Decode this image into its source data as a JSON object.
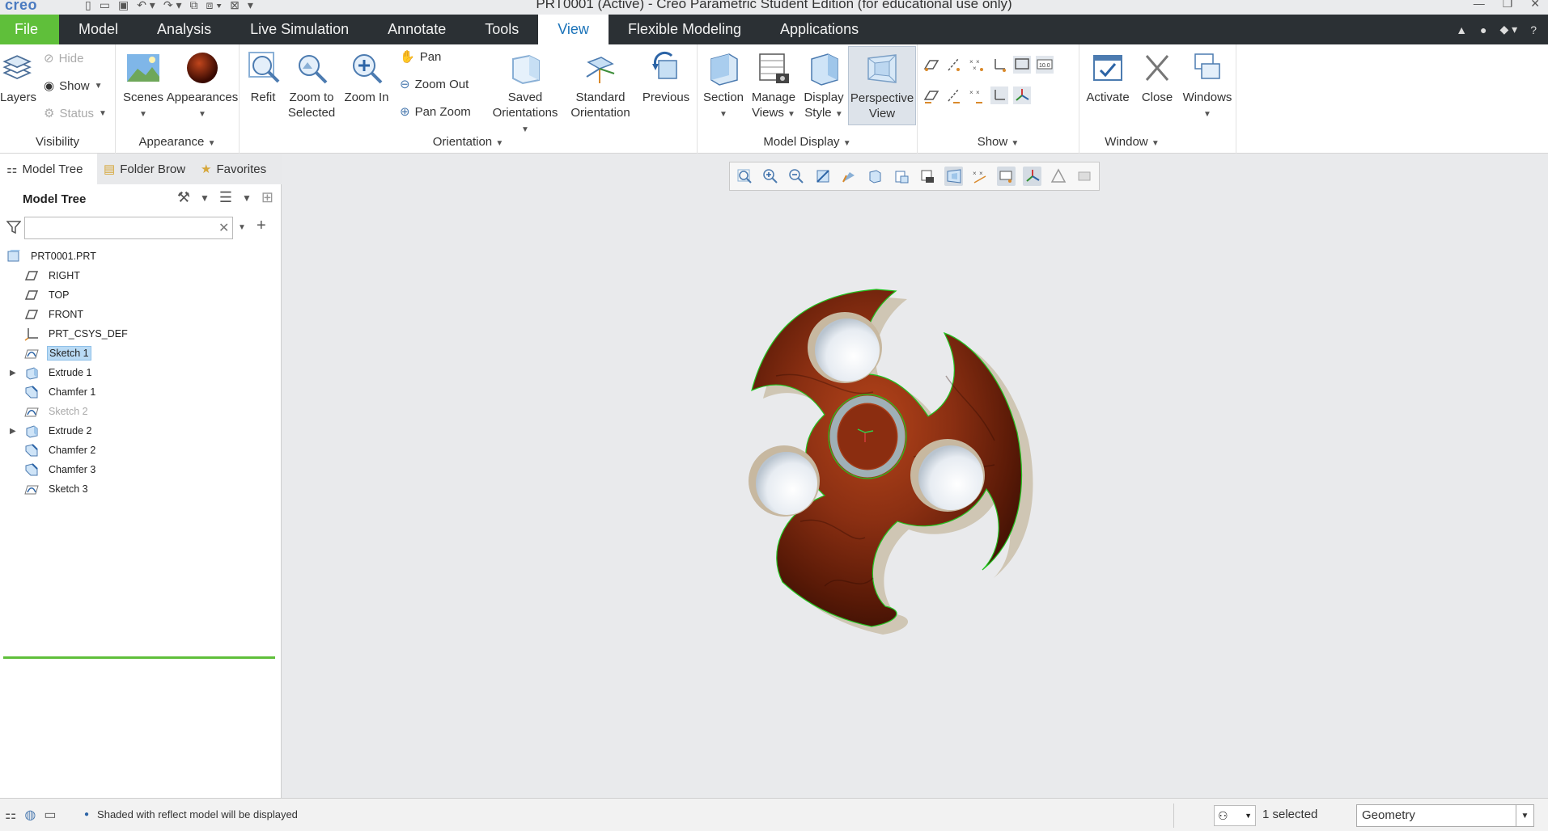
{
  "titlebar": {
    "logo": "creo",
    "title": "PRT0001 (Active) - Creo Parametric Student Edition (for educational use only)"
  },
  "tabs": [
    {
      "label": "File"
    },
    {
      "label": "Model"
    },
    {
      "label": "Analysis"
    },
    {
      "label": "Live Simulation"
    },
    {
      "label": "Annotate"
    },
    {
      "label": "Tools"
    },
    {
      "label": "View"
    },
    {
      "label": "Flexible Modeling"
    },
    {
      "label": "Applications"
    }
  ],
  "active_tab": "View",
  "ribbon": {
    "visibility": {
      "label": "Visibility",
      "layers": "Layers",
      "hide": "Hide",
      "show": "Show",
      "status": "Status"
    },
    "appearance": {
      "label": "Appearance",
      "scenes": "Scenes",
      "appearances": "Appearances"
    },
    "orientation": {
      "label": "Orientation",
      "refit": "Refit",
      "zoom_to_selected_1": "Zoom to",
      "zoom_to_selected_2": "Selected",
      "zoom_in": "Zoom In",
      "pan": "Pan",
      "zoom_out": "Zoom Out",
      "pan_zoom": "Pan Zoom",
      "saved_1": "Saved",
      "saved_2": "Orientations",
      "standard_1": "Standard",
      "standard_2": "Orientation",
      "previous": "Previous"
    },
    "model_display": {
      "label": "Model Display",
      "section": "Section",
      "manage_1": "Manage",
      "manage_2": "Views",
      "display_1": "Display",
      "display_2": "Style",
      "perspective_1": "Perspective",
      "perspective_2": "View"
    },
    "show": {
      "label": "Show"
    },
    "window": {
      "label": "Window",
      "activate": "Activate",
      "close": "Close",
      "windows": "Windows"
    }
  },
  "panel": {
    "tabs": {
      "model_tree": "Model Tree",
      "folder_browser": "Folder Brow",
      "favorites": "Favorites"
    },
    "header": "Model Tree",
    "search_value": "",
    "tree": [
      {
        "label": "PRT0001.PRT",
        "type": "part"
      },
      {
        "label": "RIGHT",
        "type": "plane"
      },
      {
        "label": "TOP",
        "type": "plane"
      },
      {
        "label": "FRONT",
        "type": "plane"
      },
      {
        "label": "PRT_CSYS_DEF",
        "type": "csys"
      },
      {
        "label": "Sketch 1",
        "type": "sketch",
        "selected": true
      },
      {
        "label": "Extrude 1",
        "type": "extrude",
        "expandable": true
      },
      {
        "label": "Chamfer 1",
        "type": "chamfer"
      },
      {
        "label": "Sketch 2",
        "type": "sketch",
        "dim": true
      },
      {
        "label": "Extrude 2",
        "type": "extrude",
        "expandable": true
      },
      {
        "label": "Chamfer 2",
        "type": "chamfer"
      },
      {
        "label": "Chamfer 3",
        "type": "chamfer"
      },
      {
        "label": "Sketch 3",
        "type": "sketch"
      }
    ]
  },
  "status": {
    "message": "Shaded with reflect model will be displayed",
    "selected": "1 selected",
    "filter": "Geometry"
  },
  "colors": {
    "file_tab": "#5fbf3a",
    "tab_bar": "#2b3034",
    "active_tab_text": "#1b73b9",
    "model_wood": "#8a2f12",
    "edge_highlight": "#22c31f"
  }
}
